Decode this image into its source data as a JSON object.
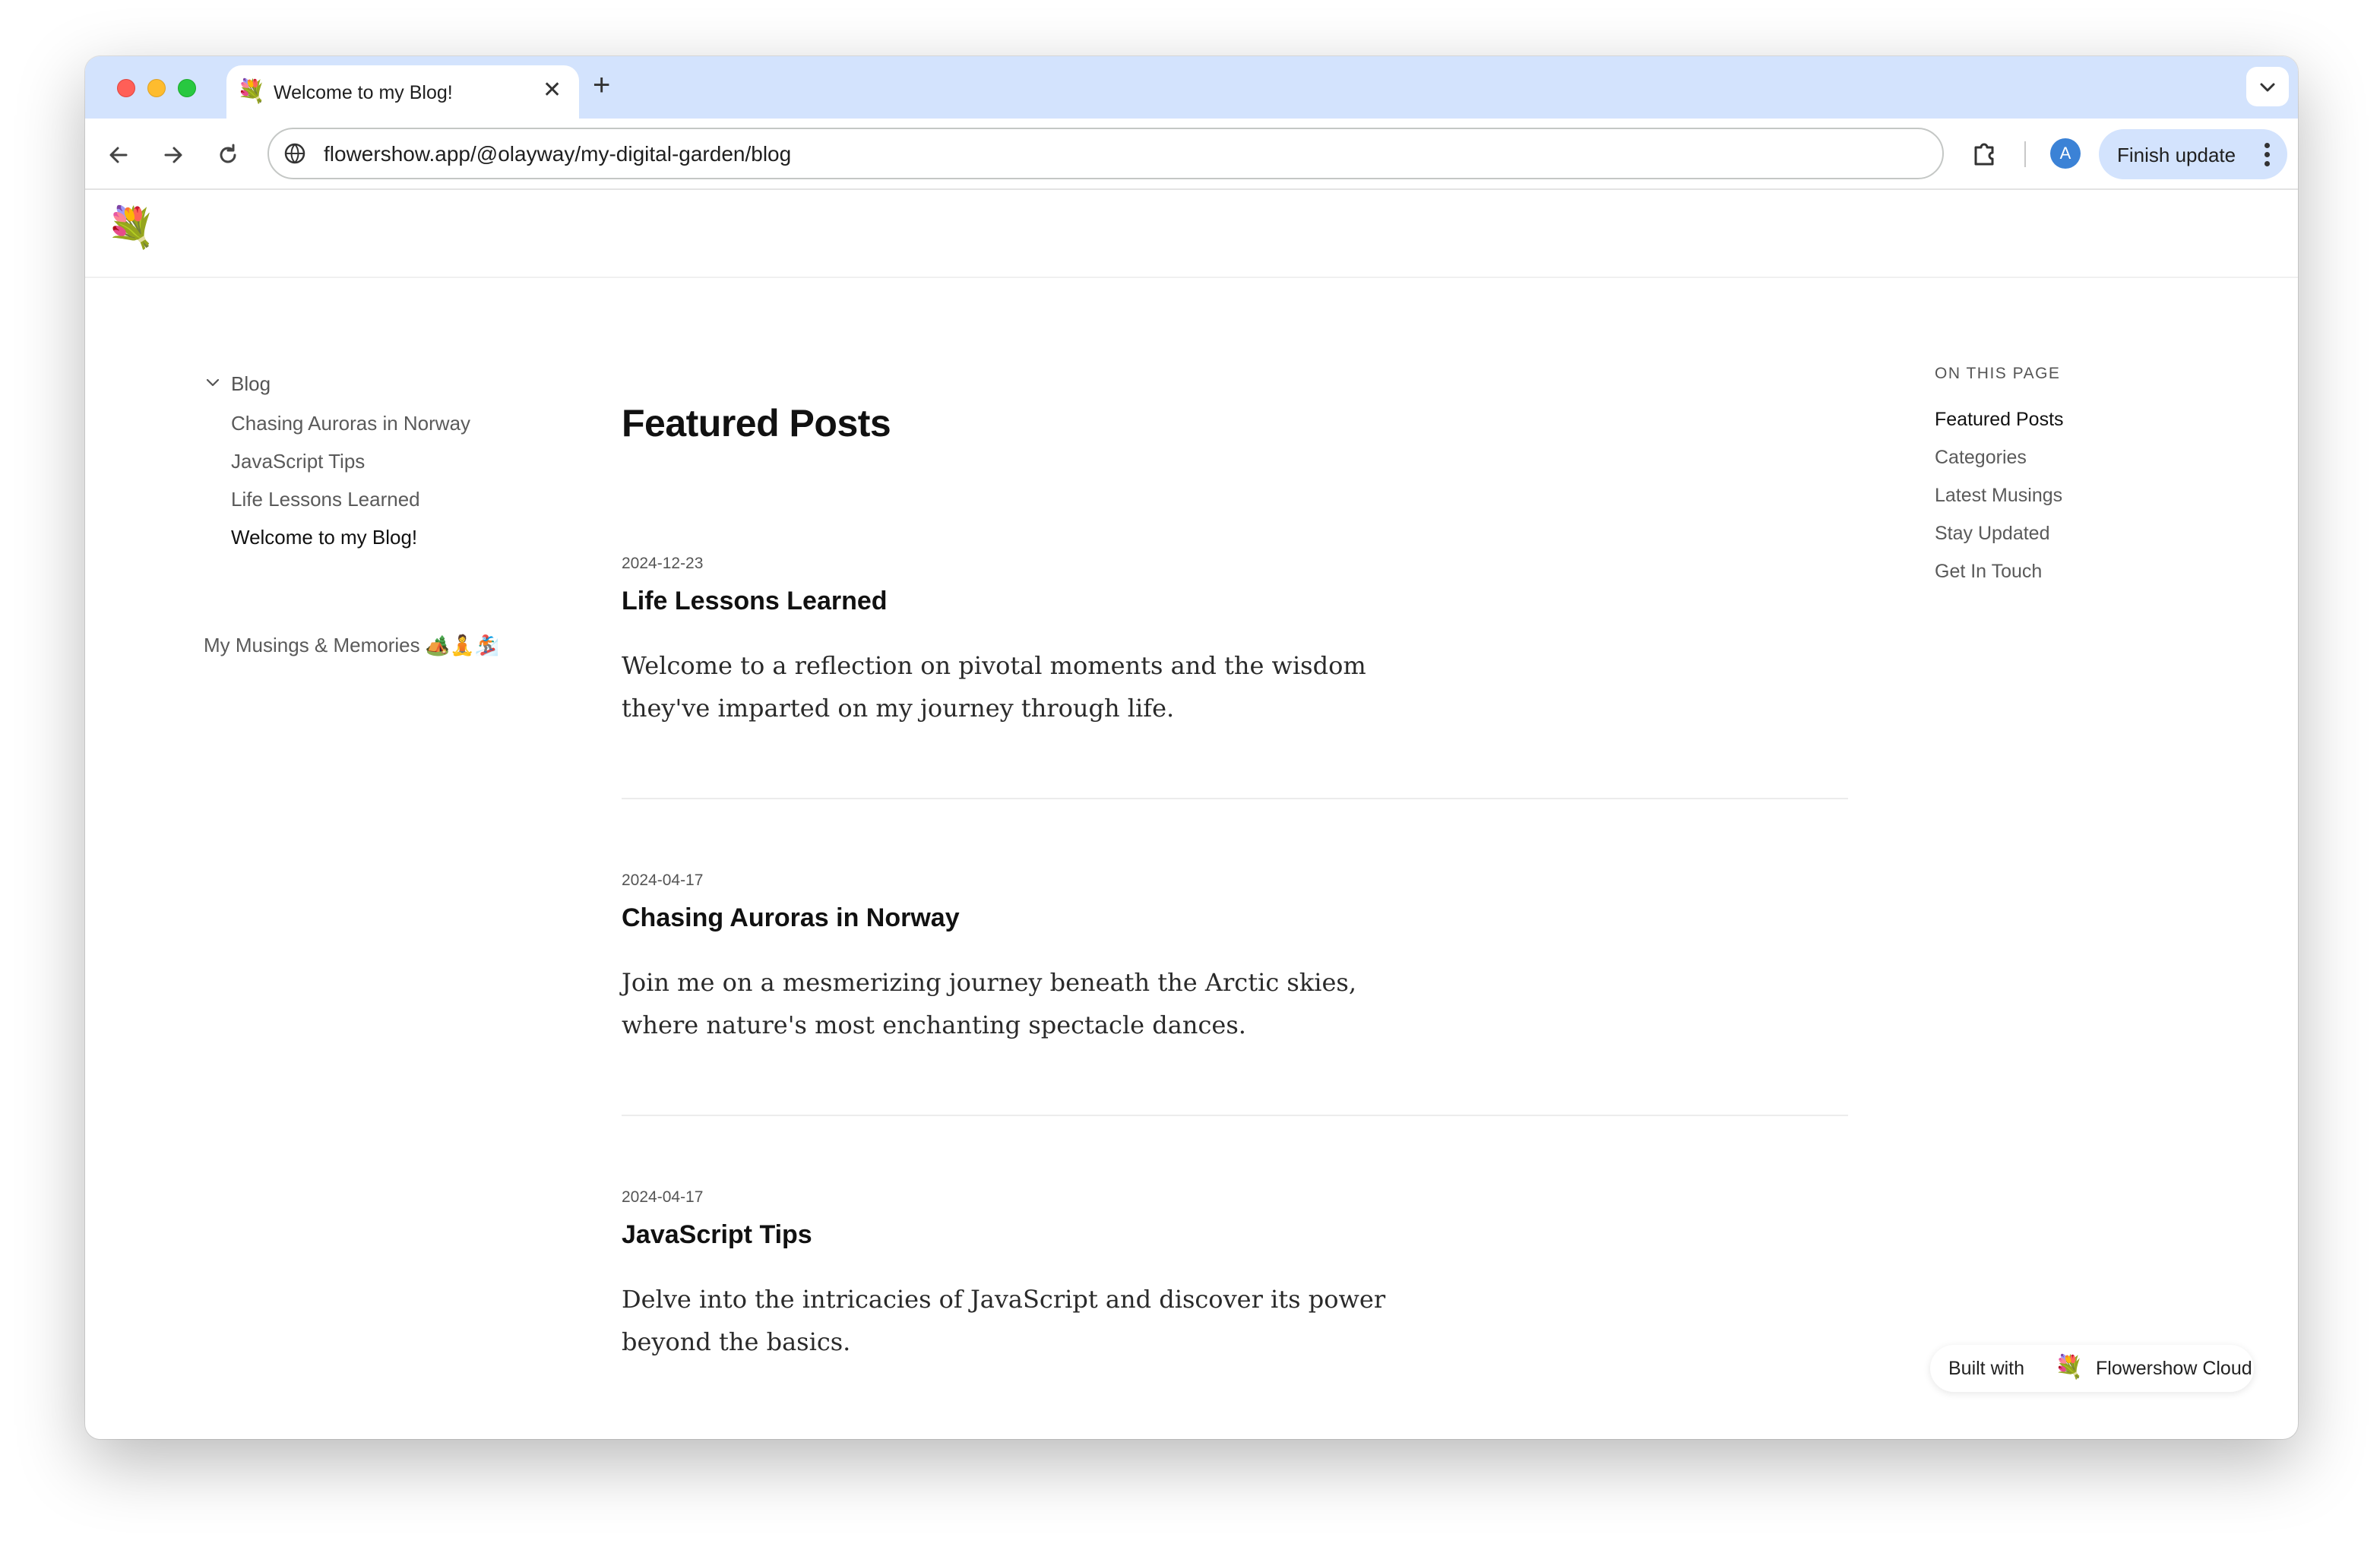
{
  "browser": {
    "tab": {
      "favicon": "💐",
      "title": "Welcome to my Blog!",
      "close_glyph": "✕"
    },
    "new_tab_glyph": "+",
    "tab_search_glyph": "⌄",
    "address_bar": {
      "url": "flowershow.app/@olayway/my-digital-garden/blog"
    },
    "profile_initial": "A",
    "update_button_label": "Finish update",
    "icons": {
      "back": "arrow-left-icon",
      "forward": "arrow-right-icon",
      "reload": "reload-icon",
      "site_info": "site-info-icon",
      "extensions": "puzzle-icon",
      "menu": "kebab-menu-icon"
    }
  },
  "site": {
    "logo": "💐"
  },
  "sidebar": {
    "section_label": "Blog",
    "items": [
      {
        "label": "Chasing Auroras in Norway",
        "active": false
      },
      {
        "label": "JavaScript Tips",
        "active": false
      },
      {
        "label": "Life Lessons Learned",
        "active": false
      },
      {
        "label": "Welcome to my Blog!",
        "active": true
      }
    ],
    "musings_label": "My Musings & Memories 🏕️🧘🏂"
  },
  "main": {
    "title": "Featured Posts",
    "posts": [
      {
        "date": "2024-12-23",
        "title": "Life Lessons Learned",
        "description": "Welcome to a reflection on pivotal moments and the wisdom they've imparted on my journey through life."
      },
      {
        "date": "2024-04-17",
        "title": "Chasing Auroras in Norway",
        "description": "Join me on a mesmerizing journey beneath the Arctic skies, where nature's most enchanting spectacle dances."
      },
      {
        "date": "2024-04-17",
        "title": "JavaScript Tips",
        "description": "Delve into the intricacies of JavaScript and discover its power beyond the basics."
      }
    ]
  },
  "toc": {
    "heading": "ON THIS PAGE",
    "items": [
      {
        "label": "Featured Posts",
        "active": true
      },
      {
        "label": "Categories",
        "active": false
      },
      {
        "label": "Latest Musings",
        "active": false
      },
      {
        "label": "Stay Updated",
        "active": false
      },
      {
        "label": "Get In Touch",
        "active": false
      }
    ]
  },
  "badge": {
    "prefix": "Built with",
    "icon": "💐",
    "brand": "Flowershow Cloud"
  },
  "colors": {
    "tab_strip": "#d3e3fd",
    "update_button": "#d3e3fd",
    "profile": "#3b82d6",
    "text_primary": "#111111",
    "text_muted": "#5a5a5a"
  }
}
